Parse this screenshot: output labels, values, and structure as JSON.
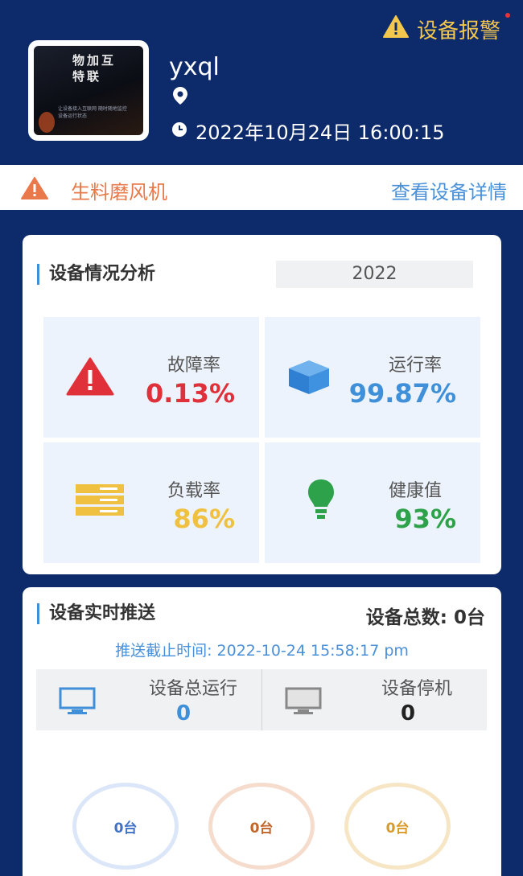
{
  "header": {
    "alarm_label": "设备报警",
    "avatar_title": "物加互特联",
    "avatar_caption": "让设备接入互联网 随时随地监控设备运行状态",
    "username": "yxql",
    "datetime": "2022年10月24日 16:00:15"
  },
  "device_bar": {
    "device_name": "生料磨风机",
    "detail_link": "查看设备详情"
  },
  "analysis": {
    "title": "设备情况分析",
    "year": "2022",
    "metrics": [
      {
        "label": "故障率",
        "value": "0.13%",
        "color": "#e0303a",
        "icon": "warning-icon"
      },
      {
        "label": "运行率",
        "value": "99.87%",
        "color": "#3f8fd9",
        "icon": "cube-icon"
      },
      {
        "label": "负载率",
        "value": "86%",
        "color": "#f0c040",
        "icon": "server-stack-icon"
      },
      {
        "label": "健康值",
        "value": "93%",
        "color": "#2ea24a",
        "icon": "lightbulb-icon"
      }
    ]
  },
  "realtime": {
    "title": "设备实时推送",
    "total_label": "设备总数:",
    "total_value": "0台",
    "deadline": "推送截止时间: 2022-10-24 15:58:17 pm",
    "running_label": "设备总运行",
    "running_value": "0",
    "stopped_label": "设备停机",
    "stopped_value": "0",
    "rings": [
      {
        "label": "0台",
        "color": "#3f72c9",
        "ring_color": "#dbe6f8"
      },
      {
        "label": "0台",
        "color": "#c0652b",
        "ring_color": "#f6dccd"
      },
      {
        "label": "0台",
        "color": "#d99a2a",
        "ring_color": "#f7e6c6"
      }
    ]
  }
}
